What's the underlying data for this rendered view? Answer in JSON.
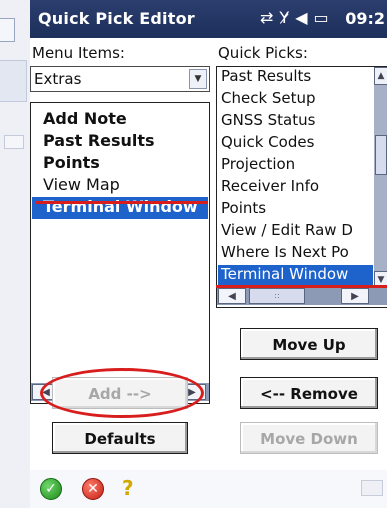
{
  "window": {
    "title": "Quick Pick Editor",
    "status_icons": [
      "sync-icon",
      "no-signal-icon",
      "volume-icon",
      "battery-icon"
    ],
    "time": "09:2"
  },
  "menu_items": {
    "label": "Menu Items:",
    "dropdown_value": "Extras",
    "items": [
      "Add Note",
      "Past Results",
      "Points",
      "View Map",
      "Terminal Window"
    ],
    "selected": "Terminal Window"
  },
  "quick_picks": {
    "label": "Quick Picks:",
    "items": [
      "Past Results",
      "Check Setup",
      "GNSS Status",
      "Quick Codes",
      "Projection",
      "Receiver Info",
      "Points",
      "View / Edit Raw D",
      "Where Is Next Po",
      "Terminal Window"
    ],
    "selected": "Terminal Window"
  },
  "buttons": {
    "add": "Add -->",
    "defaults": "Defaults",
    "move_up": "Move Up",
    "remove": "<-- Remove",
    "move_down": "Move Down"
  },
  "colors": {
    "titlebar": "#1d2f5b",
    "selection": "#1e63cc",
    "annotation": "#d81d1d"
  }
}
